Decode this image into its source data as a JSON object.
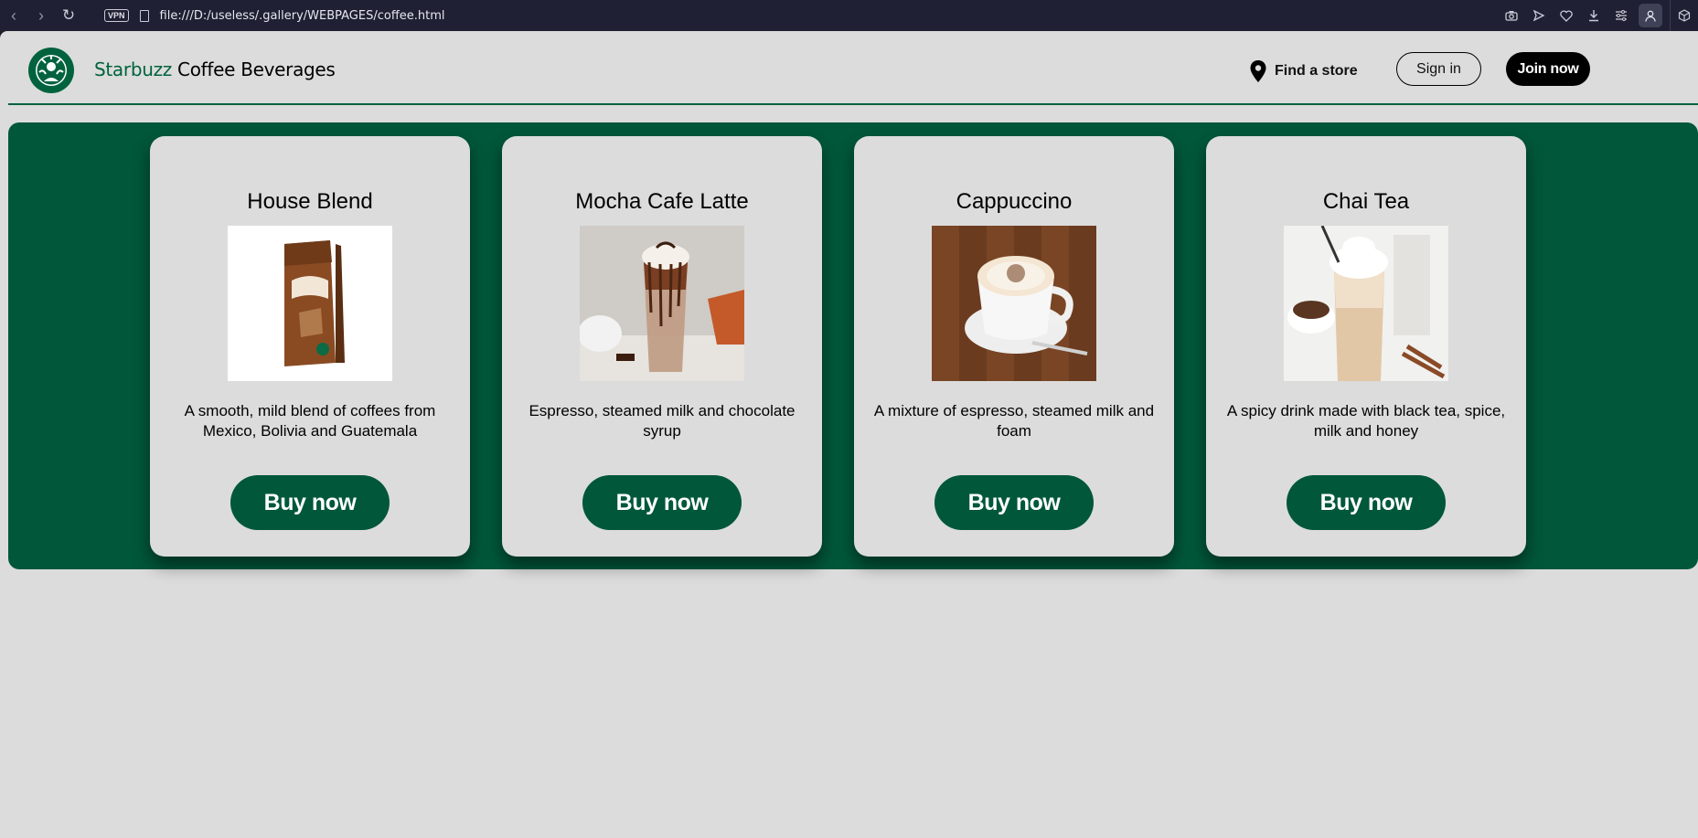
{
  "browser": {
    "vpn_label": "VPN",
    "url": "file:///D:/useless/.gallery/WEBPAGES/coffee.html"
  },
  "header": {
    "brand_accent": "Starbuzz",
    "brand_rest": " Coffee Beverages",
    "find_store": "Find a store",
    "sign_in": "Sign in",
    "join_now": "Join now"
  },
  "products": [
    {
      "title": "House Blend",
      "description": "A smooth, mild blend of coffees from Mexico, Bolivia and Guatemala",
      "button": "Buy now"
    },
    {
      "title": "Mocha Cafe Latte",
      "description": "Espresso, steamed milk and chocolate syrup",
      "button": "Buy now"
    },
    {
      "title": "Cappuccino",
      "description": "A mixture of espresso, steamed milk and foam",
      "button": "Buy now"
    },
    {
      "title": "Chai Tea",
      "description": "A spicy drink made with black tea, spice, milk and honey",
      "button": "Buy now"
    }
  ],
  "colors": {
    "brand_green": "#00573a",
    "accent_green": "#00633e",
    "page_bg": "#dcdcdc"
  }
}
